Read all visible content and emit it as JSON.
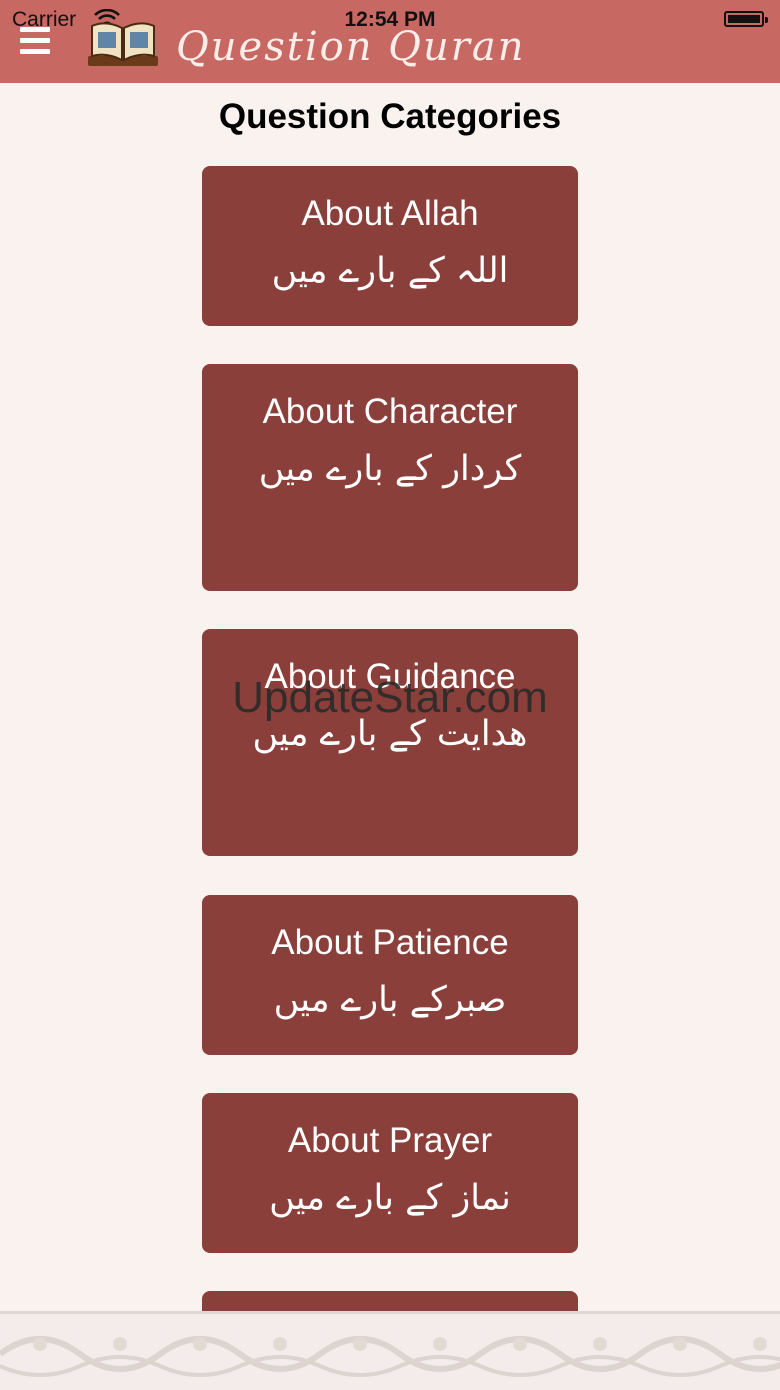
{
  "status_bar": {
    "carrier": "Carrier",
    "time": "12:54 PM"
  },
  "header": {
    "menu_icon": "hamburger-icon",
    "logo_icon": "open-book-icon",
    "app_title": "Question Quran"
  },
  "page": {
    "title": "Question Categories"
  },
  "categories": [
    {
      "en": "About Allah",
      "ur": "اللہ کے بارے میں"
    },
    {
      "en": "About Character",
      "ur": "کردار کے بارے میں"
    },
    {
      "en": "About Guidance",
      "ur": "ھدایت کے بارے میں"
    },
    {
      "en": "About Patience",
      "ur": "صبرکے بارے میں"
    },
    {
      "en": "About Prayer",
      "ur": "نماز کے بارے میں"
    }
  ],
  "watermark": "UpdateStar.com",
  "colors": {
    "header": "#c86862",
    "background": "#faf2ee",
    "button": "#8b3f3a"
  }
}
